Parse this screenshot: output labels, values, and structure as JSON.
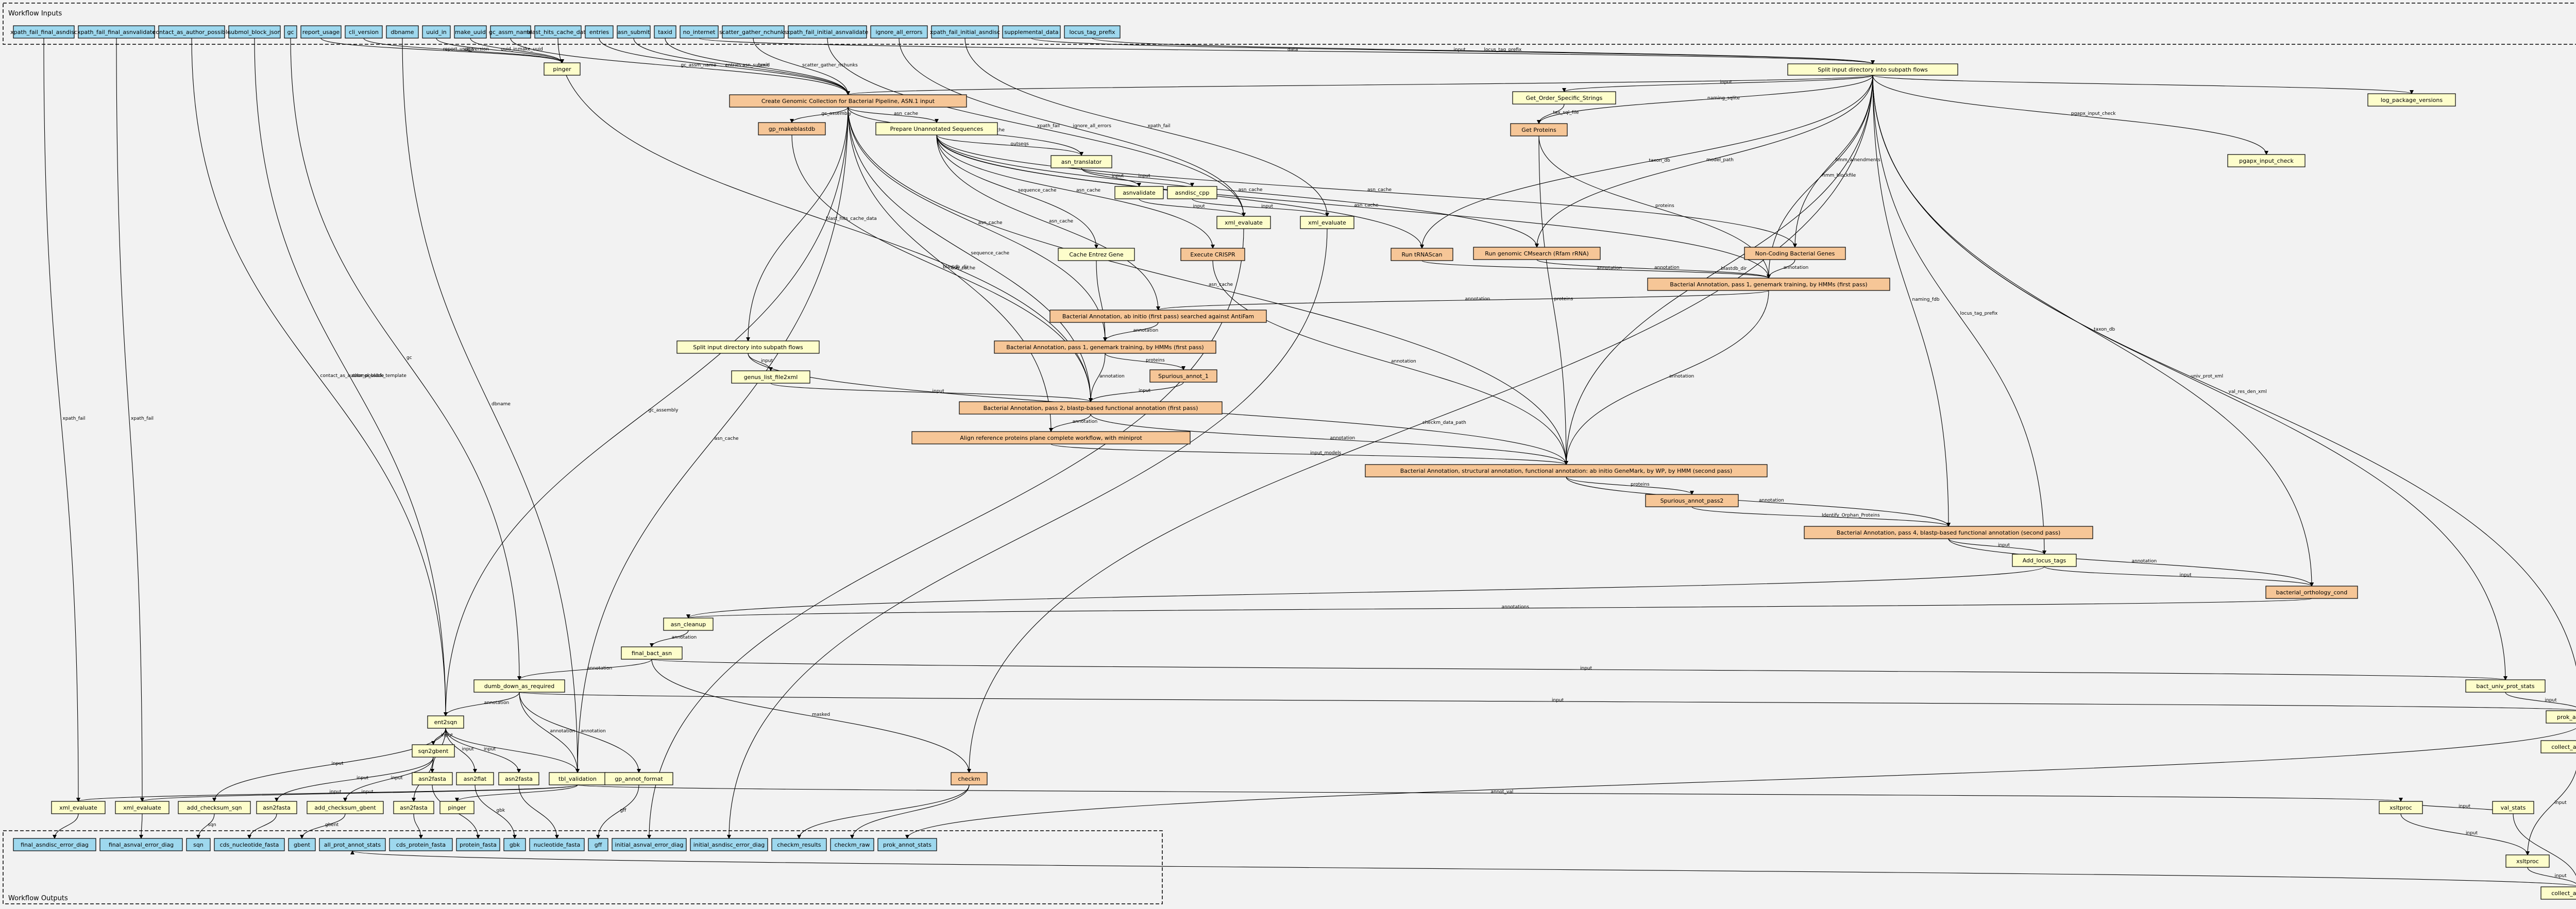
{
  "workflow_inputs": {
    "label": "Workflow Inputs",
    "items": [
      "xpath_fail_final_asndisc",
      "xpath_fail_final_asnvalidate",
      "contact_as_author_possible",
      "submol_block_json",
      "gc",
      "report_usage",
      "cli_version",
      "dbname",
      "uuid_in",
      "make_uuid",
      "gc_assm_name",
      "blast_hits_cache_data",
      "entries",
      "asn_submit",
      "taxid",
      "no_internet",
      "scatter_gather_nchunks",
      "xpath_fail_initial_asnvalidate",
      "ignore_all_errors",
      "xpath_fail_initial_asndisc",
      "supplemental_data",
      "locus_tag_prefix"
    ]
  },
  "workflow_outputs": {
    "label": "Workflow Outputs",
    "items": [
      "final_asndisc_error_diag",
      "final_asnval_error_diag",
      "sqn",
      "cds_nucleotide_fasta",
      "gbent",
      "all_prot_annot_stats",
      "cds_protein_fasta",
      "protein_fasta",
      "gbk",
      "nucleotide_fasta",
      "gff",
      "initial_asnval_error_diag",
      "initial_asndisc_error_diag",
      "checkm_results",
      "checkm_raw",
      "prok_annot_stats"
    ]
  },
  "steps": {
    "split_input_top": "Split input directory into subpath flows",
    "pinger_top": "pinger",
    "create_genomic": "Create Genomic Collection for Bacterial Pipeline, ASN.1 input",
    "get_order": "Get_Order_Specific_Strings",
    "log_package_versions": "log_package_versions",
    "gp_makeblastdb": "gp_makeblastdb",
    "prepare_unannotated": "Prepare Unannotated Sequences",
    "get_proteins": "Get Proteins",
    "pgapx_input_check": "pgapx_input_check",
    "asn_translator": "asn_translator",
    "asnvalidate": "asnvalidate",
    "asndisc_cpp": "asndisc_cpp",
    "xml_evaluate_a": "xml_evaluate",
    "xml_evaluate_b": "xml_evaluate",
    "run_genomic_cmsearch": "Run genomic CMsearch (Rfam rRNA)",
    "non_coding": "Non-Coding Bacterial Genes",
    "cache_entrez": "Cache Entrez Gene",
    "execute_crispr": "Execute CRISPR",
    "run_trnascan": "Run tRNAScan",
    "bacterial_pass1_hmm": "Bacterial Annotation, pass 1, genemark training, by HMMs (first pass)",
    "bacterial_abinitio": "Bacterial Annotation, ab initio (first pass) searched against AntiFam",
    "bacterial_pass1_genemark": "Bacterial Annotation, pass 1, genemark training, by HMMs (first pass)",
    "spurious_annot_1": "Spurious_annot_1",
    "split_input_mid": "Split input directory into subpath flows",
    "genus_list": "genus_list_file2xml",
    "bacterial_pass2": "Bacterial Annotation, pass 2, blastp-based functional annotation (first pass)",
    "align_reference": "Align reference proteins plane complete workflow, with miniprot",
    "bacterial_structural": "Bacterial Annotation, structural annotation, functional annotation: ab initio GeneMark, by WP, by HMM (second pass)",
    "spurious_annot_pass2": "Spurious_annot_pass2",
    "bacterial_pass4": "Bacterial Annotation, pass 4, blastp-based functional annotation (second pass)",
    "add_locus_tags": "Add_locus_tags",
    "bacterial_orthology": "bacterial_orthology_cond",
    "asn_cleanup": "asn_cleanup",
    "final_bact_asn": "final_bact_asn",
    "dumb_down": "dumb_down_as_required",
    "bact_univ_prot_stats": "bact_univ_prot_stats",
    "prok_annot_stats": "prok_annot_stats",
    "collect_annot_stats": "collect_annot_stats",
    "ent2sqn": "ent2sqn",
    "sqn2gbent": "sqn2gbent",
    "asn2fasta_a": "asn2fasta",
    "asn2flat": "asn2flat",
    "asn2fasta_b": "asn2fasta",
    "tbl_validation": "tbl_validation",
    "gp_annot_format": "gp_annot_format",
    "checkm": "checkm",
    "xml_evaluate_c": "xml_evaluate",
    "xml_evaluate_d": "xml_evaluate",
    "add_checksum_sqn": "add_checksum_sqn",
    "asn2fasta_c": "asn2fasta",
    "add_checksum_gbent": "add_checksum_gbent",
    "asn2fasta_d": "asn2fasta",
    "pinger_bottom": "pinger",
    "xsltproc_a": "xsltproc",
    "val_stats": "val_stats",
    "xsltproc_b": "xsltproc",
    "collect_annot_stats_bottom": "collect_annot_stats"
  },
  "edge_labels": [
    "report_usage",
    "make_uuid",
    "uuid_in",
    "gc_assm_name",
    "asn_submit",
    "entries",
    "taxid",
    "data",
    "input",
    "blastdb_dir",
    "taxon_db",
    "naming_sqlite",
    "tax_sql_file",
    "gc_assembly",
    "asn_cache",
    "sequence_cache",
    "annotation",
    "proteins",
    "input_models",
    "Identify_Orphan_Proteins",
    "goodproteins",
    "outseqs",
    "scatter_gather_nchunks",
    "self_hits",
    "checkm_data_path",
    "filter_for_new_checkm",
    "val_res_den_xml",
    "univ_prot_xml",
    "ignore_all_errors",
    "xpath_fail",
    "annot_val",
    "masked",
    "gff",
    "gbk",
    "sqn",
    "gbent",
    "annotations",
    "model_path",
    "hmm_amendments",
    "hmm_blockfile",
    "naming_fdb",
    "pgapx_input_check",
    "locus_tag_prefix",
    "submol_block_template",
    "contact_as_author_possible",
    "cli_version"
  ],
  "colors": {
    "input_fill": "#9ed8ee",
    "output_fill": "#9ed8ee",
    "step_fill": "#fdfdcb",
    "subworkflow_fill": "#f6c697",
    "edge": "#000000",
    "background": "#f2f2f2"
  }
}
